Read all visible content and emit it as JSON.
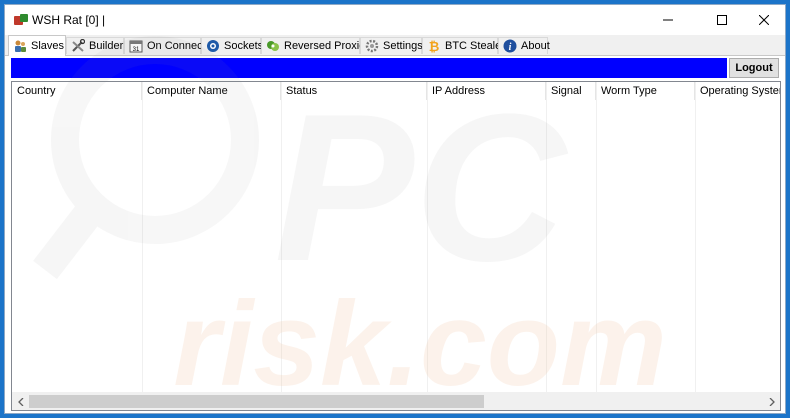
{
  "window": {
    "title": "WSH Rat [0] |"
  },
  "tabs": [
    {
      "label": "Slaves",
      "icon": "users-icon",
      "active": true
    },
    {
      "label": "Builder",
      "icon": "tools-icon"
    },
    {
      "label": "On Connect",
      "icon": "calendar-icon"
    },
    {
      "label": "Sockets",
      "icon": "socket-icon"
    },
    {
      "label": "Reversed Proxies",
      "icon": "proxy-icon"
    },
    {
      "label": "Settings",
      "icon": "gear-icon"
    },
    {
      "label": "BTC Stealer",
      "icon": "bitcoin-icon"
    },
    {
      "label": "About",
      "icon": "info-icon"
    }
  ],
  "toolbar": {
    "logout_label": "Logout",
    "bar_color": "#0000ff"
  },
  "table": {
    "columns": [
      "Country",
      "Computer Name",
      "Status",
      "IP Address",
      "Signal",
      "Worm Type",
      "Operating System"
    ],
    "rows": []
  },
  "watermark": {
    "text": "risk.com",
    "logo": "PC"
  }
}
